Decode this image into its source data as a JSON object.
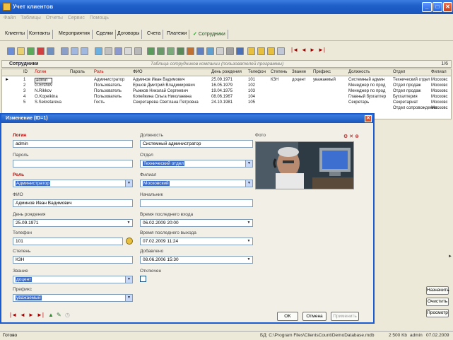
{
  "window": {
    "title": "Учет клиентов"
  },
  "menu": [
    "Файл",
    "Таблицы",
    "Отчеты",
    "Сервис",
    "Помощь"
  ],
  "tabs": [
    {
      "label": "Клиенты",
      "active": false
    },
    {
      "label": "Контакты",
      "active": false
    },
    {
      "label": "Мероприятия",
      "active": false
    },
    {
      "label": "Сделки",
      "active": false
    },
    {
      "label": "Договоры",
      "active": false
    },
    {
      "label": "Счета",
      "active": false
    },
    {
      "label": "Платежи",
      "active": false
    },
    {
      "label": "Сотрудники",
      "active": true
    }
  ],
  "grid": {
    "title": "Сотрудники",
    "subtitle": "Таблица сотрудников компании (пользователей программы)",
    "count": "1/6",
    "columns": [
      "ID",
      "Логин",
      "Пароль",
      "Роль",
      "ФИО",
      "День рождения",
      "Телефон",
      "Степень",
      "Звание",
      "Префикс",
      "Должность",
      "Отдел",
      "Филиал"
    ],
    "rows": [
      [
        "1",
        "admin",
        "",
        "Администратор",
        "Админов Иван Вадимович",
        "25.09.1971",
        "101",
        "КЗН",
        "доцент",
        "уважаемый",
        "Системный админ",
        "Технический отдел",
        "Московс"
      ],
      [
        "2",
        "G.Ershov",
        "",
        "Пользователь",
        "Ершов Дмитрий Владимирович",
        "16.05.1979",
        "102",
        "",
        "",
        "",
        "Менеджер по прод",
        "Отдел продаж",
        "Московс"
      ],
      [
        "3",
        "N.Rikkov",
        "",
        "Пользователь",
        "Рыжков Николай Сергеевич",
        "19.04.1975",
        "103",
        "",
        "",
        "",
        "Менеджер по прод",
        "Отдел продаж",
        "Московс"
      ],
      [
        "4",
        "O.Kopeikina",
        "",
        "Пользователь",
        "Копейкина Ольга Николаевна",
        "08.06.1967",
        "104",
        "",
        "",
        "",
        "Главный бухгалтер",
        "Бухгалтерия",
        "Московс"
      ],
      [
        "5",
        "S.Sekretareva",
        "",
        "Гость",
        "Секретарева Светлана Петровна",
        "24.10.1981",
        "105",
        "",
        "",
        "",
        "Секретарь",
        "Секретариат",
        "Московс"
      ],
      [
        "",
        "",
        "",
        "",
        "",
        "",
        "",
        "",
        "",
        "",
        "",
        "Отдел сопровождения",
        "Московс"
      ]
    ]
  },
  "side_buttons": [
    "Назначить",
    "Очистить",
    "Просмотр"
  ],
  "status": {
    "left": "Готово",
    "path": "БД: C:\\Program Files\\ClientsCount\\DemoDatabase.mdb",
    "size": "2 500 Kb",
    "user": "admin",
    "date": "07.02.2009"
  },
  "dialog": {
    "title": "Изменение (ID=1)",
    "fields": {
      "login_label": "Логин",
      "login": "admin",
      "password_label": "Пароль",
      "password": "",
      "role_label": "Роль",
      "role": "Администратор",
      "fio_label": "ФИО",
      "fio": "Админов Иван Вадимович",
      "birthday_label": "День рождения",
      "birthday": "25.09.1971",
      "phone_label": "Телефон",
      "phone": "101",
      "degree_label": "Степень",
      "degree": "КЗН",
      "rank_label": "Звание",
      "rank": "доцент",
      "prefix_label": "Префикс",
      "prefix": "уважаемый",
      "position_label": "Должность",
      "position": "Системный администратор",
      "dept_label": "Отдел",
      "dept": "Технический отдел",
      "branch_label": "Филиал",
      "branch": "Московский",
      "chief_label": "Начальник",
      "chief": "",
      "last_login_label": "Время последнего входа",
      "last_login": "06.02.2009 20:00",
      "last_logout_label": "Время последнего выхода",
      "last_logout": "07.02.2009 11:24",
      "added_label": "Добавлено",
      "added": "08.06.2006 15:30",
      "disabled_label": "Отключен",
      "photo_label": "Фото"
    },
    "buttons": {
      "ok": "OK",
      "cancel": "Отмена",
      "apply": "Применить"
    }
  },
  "colors": {
    "titlebar": "#1f5fc8",
    "selection": "#3a6bc8",
    "required": "#c00000"
  }
}
